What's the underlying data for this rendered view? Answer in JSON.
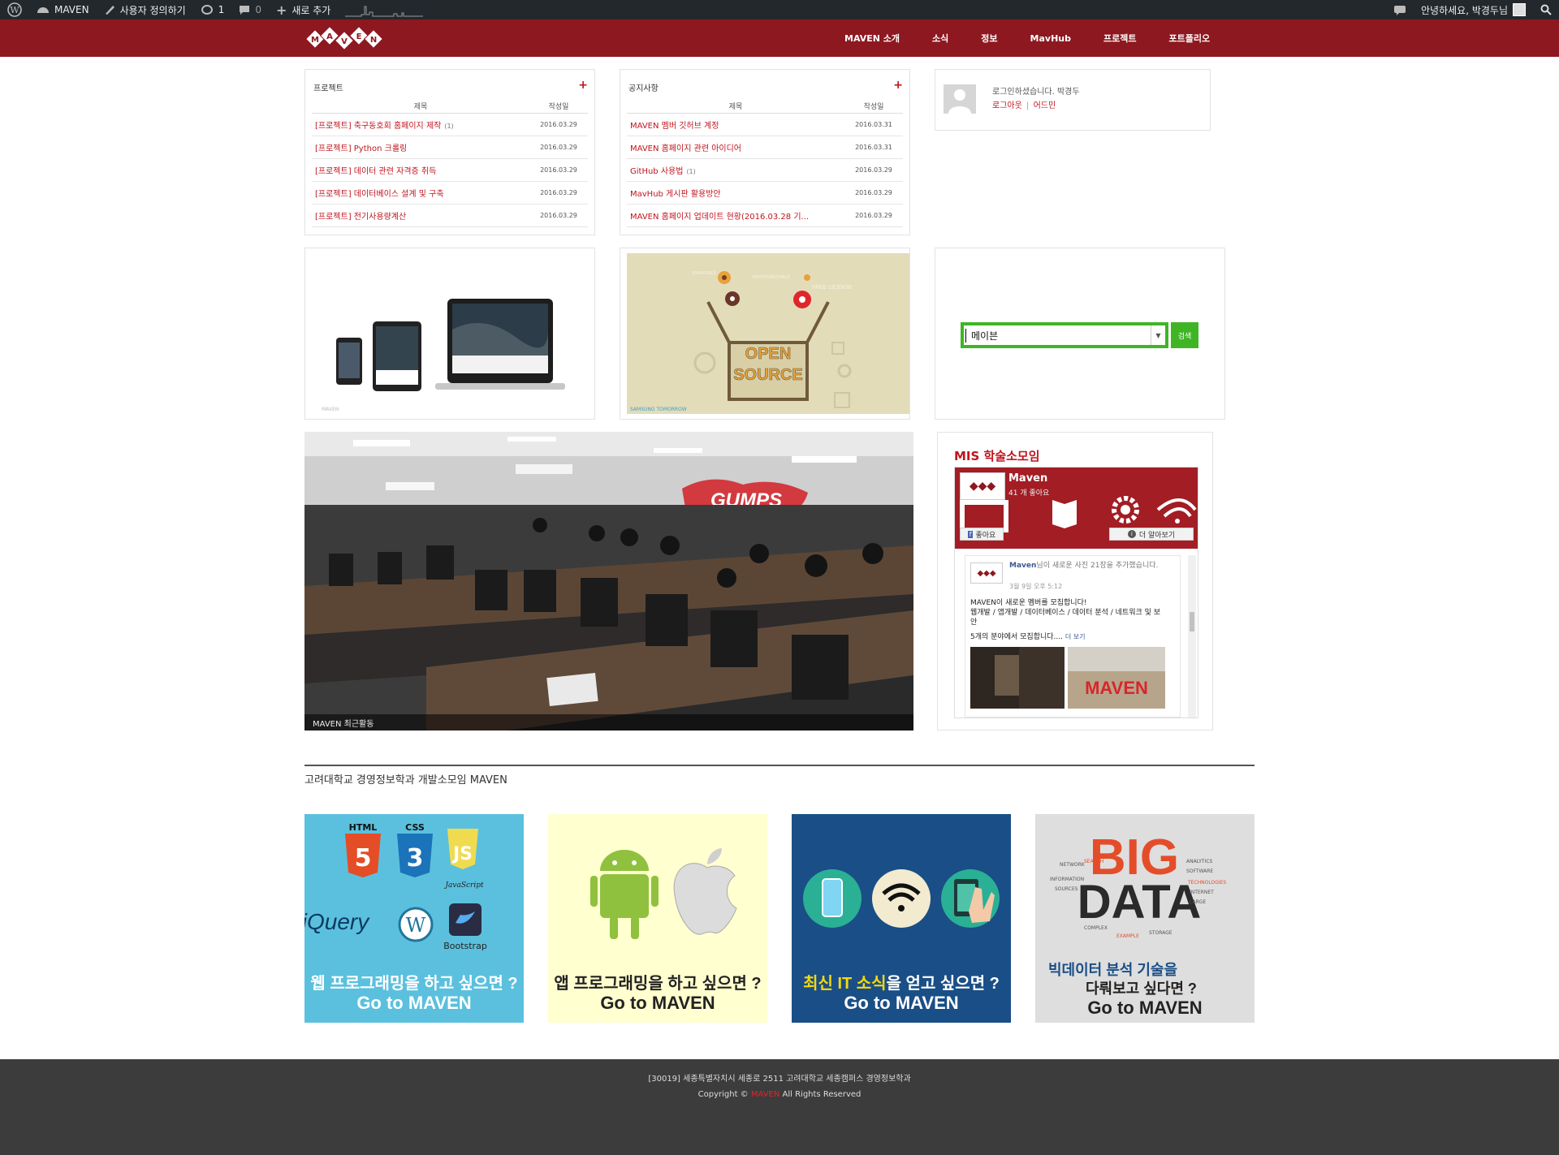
{
  "adminbar": {
    "site_name": "MAVEN",
    "customize": "사용자 정의하기",
    "updates_count": "1",
    "comments_count": "0",
    "new_label": "새로 추가",
    "greeting": "안녕하세요, 박경두님"
  },
  "nav": {
    "items": [
      "MAVEN 소개",
      "소식",
      "정보",
      "MavHub",
      "프로젝트",
      "포트폴리오"
    ]
  },
  "colors": {
    "brand": "#8e1820",
    "link": "#c0141e",
    "search_green": "#3fb526"
  },
  "projects": {
    "title": "프로젝트",
    "col_title": "제목",
    "col_date": "작성일",
    "rows": [
      {
        "title": "[프로젝트] 축구동호회 홈페이지 제작",
        "count": "(1)",
        "date": "2016.03.29"
      },
      {
        "title": "[프로젝트] Python 크롤링",
        "count": "",
        "date": "2016.03.29"
      },
      {
        "title": "[프로젝트] 데이터 관련 자격증 취득",
        "count": "",
        "date": "2016.03.29"
      },
      {
        "title": "[프로젝트] 데이터베이스 설계 및 구축",
        "count": "",
        "date": "2016.03.29"
      },
      {
        "title": "[프로젝트] 전기사용량계산",
        "count": "",
        "date": "2016.03.29"
      }
    ]
  },
  "notices": {
    "title": "공지사항",
    "col_title": "제목",
    "col_date": "작성일",
    "rows": [
      {
        "title": "MAVEN 멤버 깃허브 계정",
        "count": "",
        "date": "2016.03.31"
      },
      {
        "title": "MAVEN 홈페이지 관련 아이디어",
        "count": "",
        "date": "2016.03.31"
      },
      {
        "title": "GitHub 사용법",
        "count": "(1)",
        "date": "2016.03.29"
      },
      {
        "title": "MavHub 게시판 활용방안",
        "count": "",
        "date": "2016.03.29"
      },
      {
        "title": "MAVEN 홈페이지 업데이트 현황(2016.03.28 기...",
        "count": "",
        "date": "2016.03.29"
      }
    ]
  },
  "login": {
    "text": "로그인하셨습니다. 박경두",
    "logout": "로그아웃",
    "separator": "|",
    "admin": "어드민"
  },
  "opensource": {
    "line1": "OPEN",
    "line2": "SOURCE",
    "caption": "SAMSUNG TOMORROW",
    "tags": [
      "SHAREABLE",
      "REDISTRIBUTABLE",
      "FREE LICENSE"
    ]
  },
  "search": {
    "value": "메이븐",
    "button": "검색"
  },
  "slider": {
    "caption": "MAVEN 최근활동"
  },
  "fb": {
    "heading": "MIS 학술소모임",
    "page_name": "Maven",
    "likes": "41 개 좋아요",
    "like_btn": "좋아요",
    "more_btn": "더 알아보기",
    "post_author": "Maven",
    "post_action": "님이 새로운 사진 21장을 추가했습니다.",
    "post_time": "3월 9일 오후 5:12",
    "post_line1": "MAVEN이 새로운 멤버를 모집합니다!",
    "post_line2": "웹개발 / 앱개발 / 데이터베이스 / 데이터 분석 / 네트워크 및 보안",
    "post_line3": "5개의 분야에서 모집합니다....",
    "see_more": "더 보기",
    "photo_text": "MAVEN"
  },
  "section": {
    "title": "고려대학교 경영정보학과 개발소모임 MAVEN"
  },
  "cards": [
    {
      "line1": "웹 프로그래밍을 하고 싶으면 ?",
      "line2": "Go to MAVEN",
      "icons": [
        "HTML",
        "CSS",
        "JavaScript",
        "jQuery",
        "Bootstrap"
      ]
    },
    {
      "line1": "앱 프로그래밍을 하고 싶으면 ?",
      "line2": "Go to MAVEN"
    },
    {
      "line1a": "최신 IT 소식",
      "line1b": "을 얻고 싶으면 ?",
      "line2": "Go to MAVEN"
    },
    {
      "line1": "빅데이터 분석 기술을",
      "line1c": "다뤄보고 싶다면 ?",
      "line2": "Go to MAVEN",
      "big": "BIG",
      "data": "DATA"
    }
  ],
  "footer": {
    "address": "[30019] 세종특별자치시 세종로 2511 고려대학교 세종캠퍼스 경영정보학과",
    "copyright_pre": "Copyright ©",
    "copyright_brand": "MAVEN",
    "copyright_post": "All Rights Reserved"
  }
}
